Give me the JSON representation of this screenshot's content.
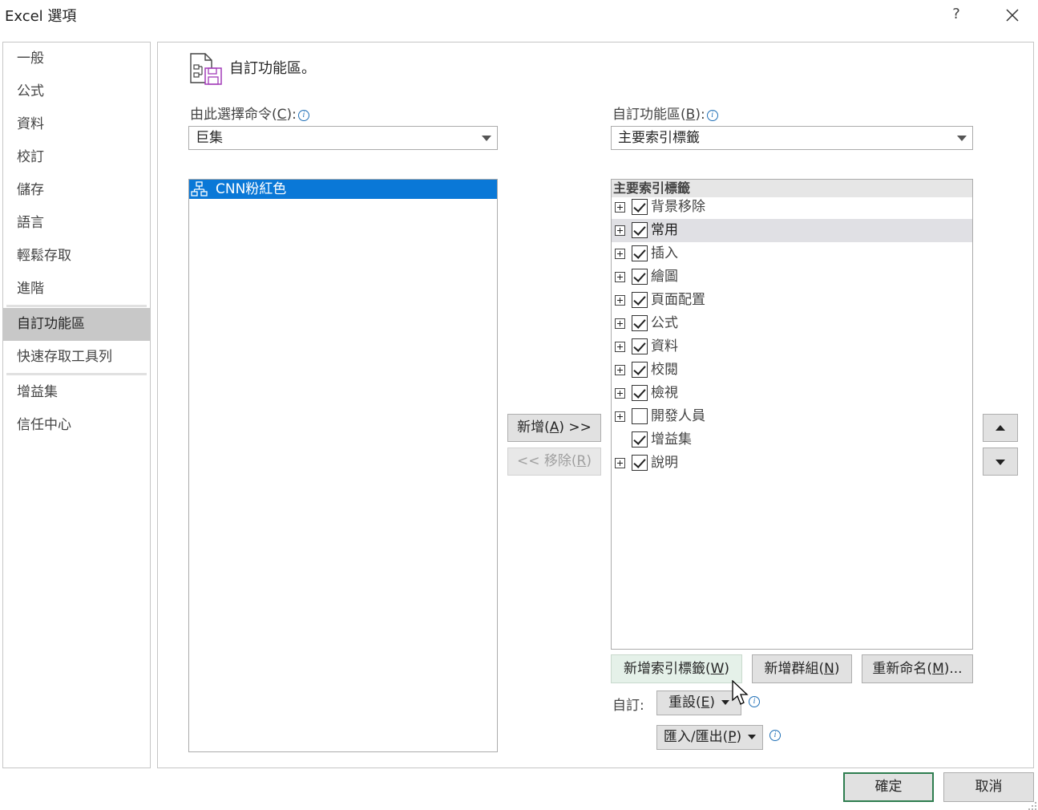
{
  "window": {
    "title": "Excel 選項",
    "help_label": "?",
    "close_icon": "close-icon"
  },
  "nav": {
    "items": [
      {
        "label": "一般",
        "selected": false
      },
      {
        "label": "公式",
        "selected": false
      },
      {
        "label": "資料",
        "selected": false
      },
      {
        "label": "校訂",
        "selected": false
      },
      {
        "label": "儲存",
        "selected": false
      },
      {
        "label": "語言",
        "selected": false
      },
      {
        "label": "輕鬆存取",
        "selected": false
      },
      {
        "label": "進階",
        "selected": false
      },
      {
        "label": "自訂功能區",
        "selected": true
      },
      {
        "label": "快速存取工具列",
        "selected": false
      },
      {
        "label": "增益集",
        "selected": false
      },
      {
        "label": "信任中心",
        "selected": false
      }
    ]
  },
  "header": {
    "title": "自訂功能區。",
    "icon": "customize-ribbon-icon"
  },
  "left": {
    "label_text": "由此選擇命令(",
    "label_key": "C",
    "label_suffix": "):",
    "dropdown_value": "巨集",
    "list_items": [
      {
        "label": "CNN粉紅色",
        "icon": "macro-icon",
        "selected": true
      }
    ]
  },
  "middle": {
    "add_prefix": "新增(",
    "add_key": "A",
    "add_suffix": ") >>",
    "remove_prefix": "<< 移除(",
    "remove_key": "R",
    "remove_suffix": ")"
  },
  "right": {
    "label_text": "自訂功能區(",
    "label_key": "B",
    "label_suffix": "):",
    "dropdown_value": "主要索引標籤",
    "tree_header": "主要索引標籤",
    "tree_items": [
      {
        "label": "背景移除",
        "checked": true,
        "expandable": true,
        "highlighted": false
      },
      {
        "label": "常用",
        "checked": true,
        "expandable": true,
        "highlighted": true
      },
      {
        "label": "插入",
        "checked": true,
        "expandable": true,
        "highlighted": false
      },
      {
        "label": "繪圖",
        "checked": true,
        "expandable": true,
        "highlighted": false
      },
      {
        "label": "頁面配置",
        "checked": true,
        "expandable": true,
        "highlighted": false
      },
      {
        "label": "公式",
        "checked": true,
        "expandable": true,
        "highlighted": false
      },
      {
        "label": "資料",
        "checked": true,
        "expandable": true,
        "highlighted": false
      },
      {
        "label": "校閱",
        "checked": true,
        "expandable": true,
        "highlighted": false
      },
      {
        "label": "檢視",
        "checked": true,
        "expandable": true,
        "highlighted": false
      },
      {
        "label": "開發人員",
        "checked": false,
        "expandable": true,
        "highlighted": false
      },
      {
        "label": "增益集",
        "checked": true,
        "expandable": false,
        "highlighted": false
      },
      {
        "label": "說明",
        "checked": true,
        "expandable": true,
        "highlighted": false
      }
    ],
    "new_tab_prefix": "新增索引標籤(",
    "new_tab_key": "W",
    "new_tab_suffix": ")",
    "new_group_prefix": "新增群組(",
    "new_group_key": "N",
    "new_group_suffix": ")",
    "rename_prefix": "重新命名(",
    "rename_key": "M",
    "rename_suffix": ")...",
    "customize_label": "自訂:",
    "reset_prefix": "重設(",
    "reset_key": "E",
    "reset_suffix": ")",
    "import_prefix": "匯入/匯出(",
    "import_key": "P",
    "import_suffix": ")"
  },
  "footer": {
    "ok_label": "確定",
    "cancel_label": "取消"
  },
  "colors": {
    "selection_blue": "#0a78d7",
    "nav_selected": "#c8c8c8",
    "default_button_border": "#2e7d4f",
    "info_icon": "#1f6fb6"
  }
}
